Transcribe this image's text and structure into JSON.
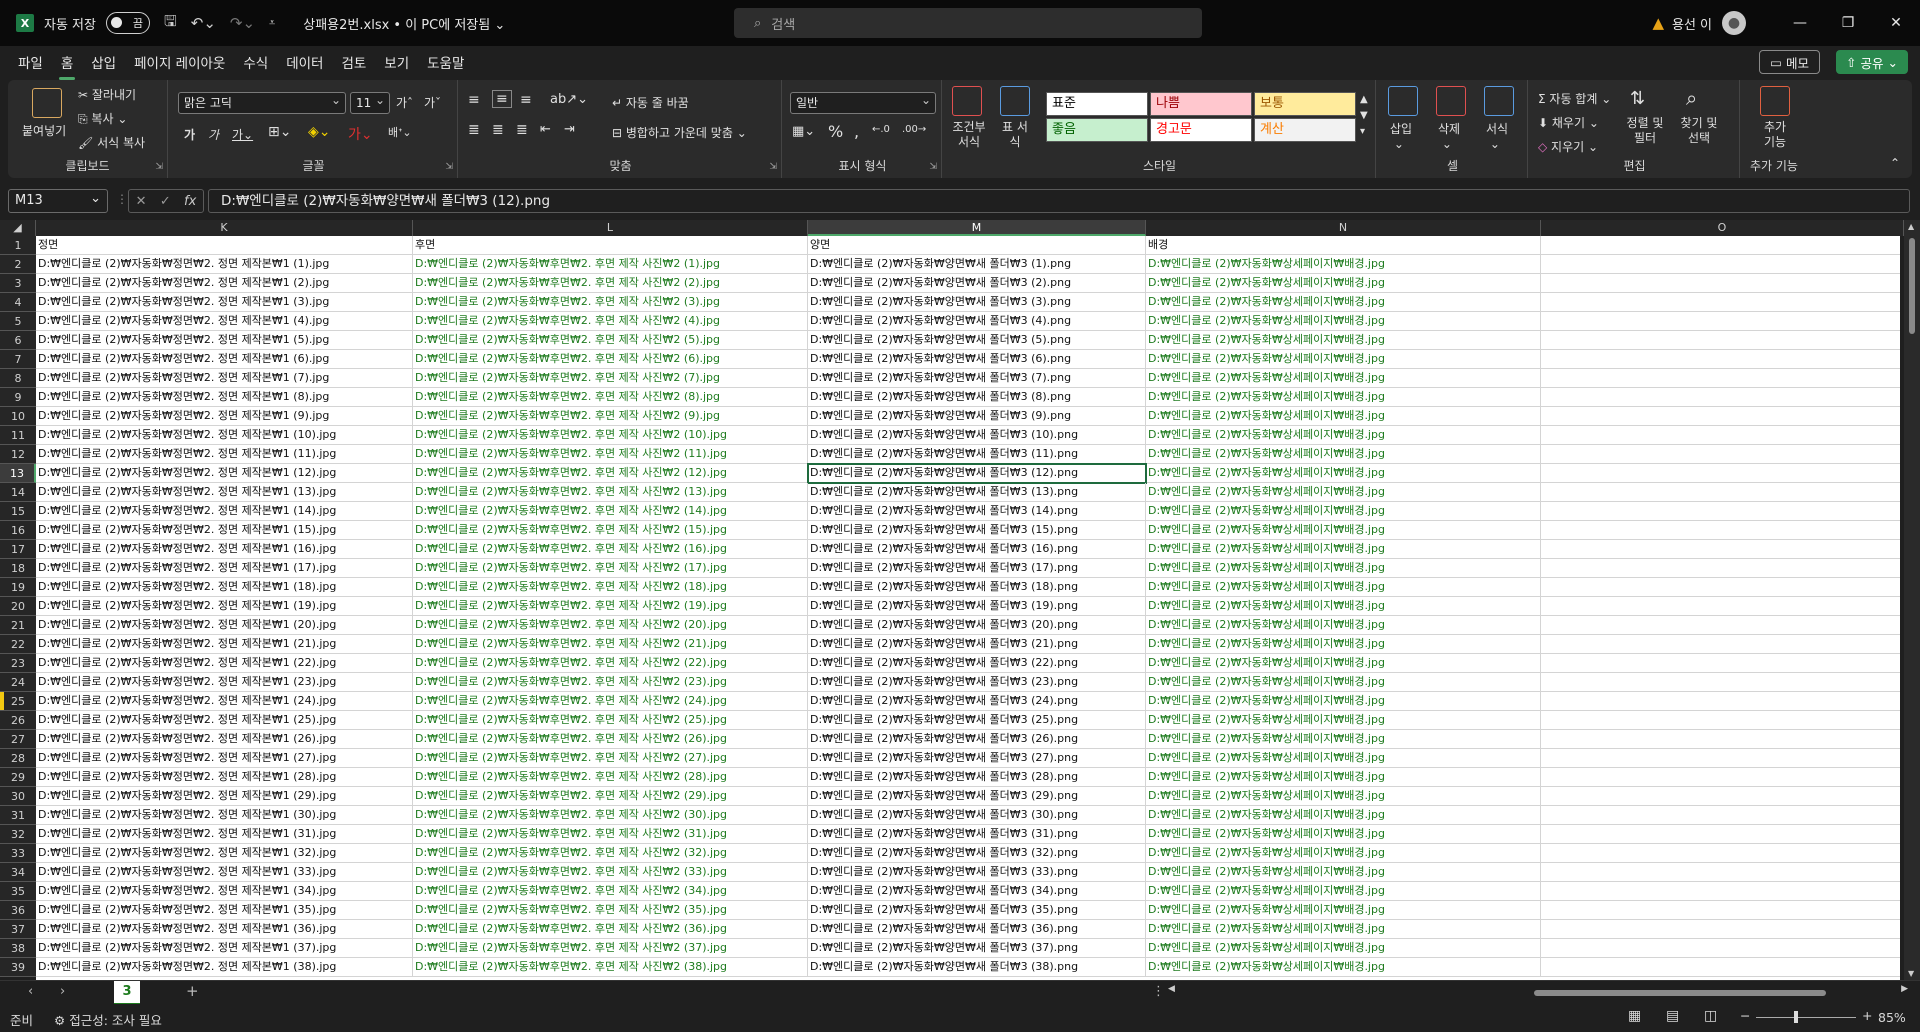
{
  "titlebar": {
    "logo": "X",
    "autosave_label": "자동 저장",
    "autosave_state": "끔",
    "filename": "상패용2번.xlsx • 이 PC에 저장됨",
    "search_placeholder": "검색",
    "user_name": "용선 이"
  },
  "menu": {
    "items": [
      "파일",
      "홈",
      "삽입",
      "페이지 레이아웃",
      "수식",
      "데이터",
      "검토",
      "보기",
      "도움말"
    ],
    "memo": "메모",
    "share": "공유"
  },
  "ribbon": {
    "clipboard": {
      "paste": "붙여넣기",
      "cut": "잘라내기",
      "copy": "복사",
      "format_painter": "서식 복사",
      "label": "클립보드"
    },
    "font": {
      "name": "맑은 고딕",
      "size": "11",
      "label": "글꼴"
    },
    "align": {
      "wrap": "자동 줄 바꿈",
      "merge": "병합하고 가운데 맞춤",
      "label": "맞춤"
    },
    "number": {
      "format": "일반",
      "label": "표시 형식"
    },
    "styles": {
      "conditional": "조건부 서식",
      "table": "표 서식",
      "cells": [
        "표준",
        "나쁨",
        "보통",
        "좋음",
        "경고문",
        "계산"
      ],
      "label": "스타일"
    },
    "cells": {
      "insert": "삽입",
      "delete": "삭제",
      "format": "서식",
      "label": "셀"
    },
    "editing": {
      "autosum": "자동 합계",
      "fill": "채우기",
      "clear": "지우기",
      "sort": "정렬 및 필터",
      "find": "찾기 및 선택",
      "label": "편집"
    },
    "addins": {
      "label_btn": "추가 기능",
      "label": "추가 기능"
    }
  },
  "formula_bar": {
    "name_box": "M13",
    "fx": "fx",
    "content": "D:₩엔디클로 (2)₩자동화₩양면₩새 폴더₩3 (12).png"
  },
  "grid": {
    "columns": [
      "K",
      "L",
      "M",
      "N",
      "O"
    ],
    "selected_column": "M",
    "selected_row": 13,
    "header_row": [
      "정면",
      "후면",
      "양면",
      "배경"
    ],
    "col_k_prefix": "D:₩엔디클로 (2)₩자동화₩정면₩2. 정면 제작본₩1 (",
    "col_k_suffix": ").jpg",
    "col_l_prefix": "D:₩엔디클로 (2)₩자동화₩후면₩2. 후면 제작 사진₩2 (",
    "col_l_suffix": ").jpg",
    "col_m_prefix": "D:₩엔디클로 (2)₩자동화₩양면₩새 폴더₩3 (",
    "col_m_suffix": ").png",
    "col_n_value": "D:₩엔디클로 (2)₩자동화₩상세페이지₩배경.jpg",
    "data_row_count": 38,
    "highlighted_row": 25
  },
  "sheets": {
    "tabs": [
      "3"
    ],
    "add": "+"
  },
  "status": {
    "ready": "준비",
    "accessibility": "접근성: 조사 필요",
    "zoom": "85%"
  }
}
